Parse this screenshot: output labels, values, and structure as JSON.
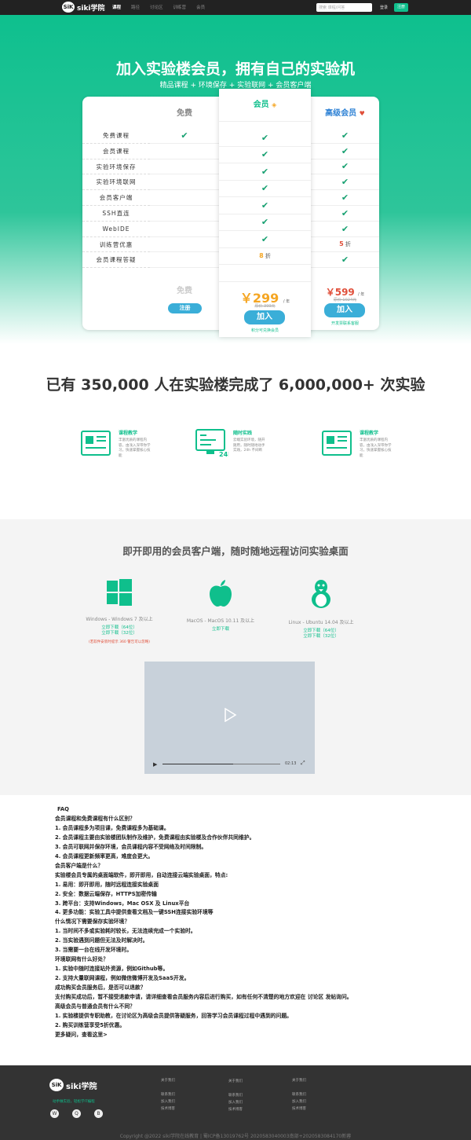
{
  "nav": {
    "logo_badge": "SiK",
    "logo_text": "siki学院",
    "links": [
      "课程",
      "路径",
      "讨论区",
      "训练营",
      "会员"
    ],
    "search_placeholder": "搜索 课程/问答",
    "login": "登录",
    "signup": "注册"
  },
  "hero": {
    "title": "加入实验楼会员，拥有自己的实验机",
    "subtitle": "精品课程 + 环境保存 + 实验联网 + 会员客户端"
  },
  "pricing": {
    "free_title": "免费",
    "member_title": "会员",
    "advanced_title": "高级会员",
    "features": [
      "免费课程",
      "会员课程",
      "实验环境保存",
      "实验环境联网",
      "会员客户端",
      "SSH直连",
      "WebIDE",
      "训练营优惠",
      "会员课程答疑"
    ],
    "free_checks": [
      true,
      false,
      false,
      false,
      false,
      false,
      false,
      false,
      false
    ],
    "member_checks": [
      true,
      true,
      true,
      true,
      true,
      true,
      true,
      false,
      false
    ],
    "advanced_checks": [
      true,
      true,
      true,
      true,
      true,
      true,
      true,
      false,
      true
    ],
    "member_discount_num": "8",
    "member_discount_unit": "折",
    "advanced_discount_num": "5",
    "advanced_discount_unit": "折",
    "free_price_label": "免费",
    "free_button": "注册",
    "member_price": "￥299",
    "member_price_unit": "/ 年",
    "member_old_price": "原价 399元",
    "member_button": "加入",
    "member_note": "积分可兑换会员",
    "advanced_price": "￥599",
    "advanced_price_unit": "/ 年",
    "advanced_old_price": "原价 1024元",
    "advanced_button": "加入",
    "advanced_note": "开发票联系客服"
  },
  "stats": "已有 350,000 人在实验楼完成了 6,000,000+ 次实验",
  "features": [
    {
      "title": "课程教学",
      "desc": "丰富优质的课程内容，由浅入深带你学习，快速掌握核心技能"
    },
    {
      "title": "随时实践",
      "desc": "云端实验环境，随开随用，随时随地动手实践，24h 不间断"
    },
    {
      "title": "课程教学",
      "desc": "丰富优质的课程内容，由浅入深带你学习，快速掌握核心技能"
    }
  ],
  "client": {
    "title": "即开即用的会员客户端，随时随地远程访问实验桌面",
    "windows_name": "Windows - Windows 7 及以上",
    "windows_link1": "立即下载（64位）",
    "windows_link2": "立即下载（32位）",
    "windows_note": "(若软件安装时提示 360 警告可以忽略)",
    "mac_name": "MacOS - MacOS 10.11 及以上",
    "mac_link": "立即下载",
    "linux_name": "Linux - Ubuntu 14.04 及以上",
    "linux_link1": "立即下载（64位）",
    "linux_link2": "立即下载（32位）",
    "video_time": "02:13"
  },
  "faq": [
    "FAQ",
    "会员课程和免费课程有什么区别？",
    "1. 会员课程多为项目课，免费课程多为基础课。",
    "2. 会员课程主要由实验楼团队制作及维护，免费课程由实验楼及合作伙伴共同维护。",
    "3. 会员可联网并保存环境，会员课程内容不受网络及时间限制。",
    "4. 会员课程更新频率更高，难度会更大。",
    "会员客户端是什么？",
    "实验楼会员专属的桌面端软件，即开即用，自动连接云端实验桌面，特点:",
    "1. 易用：即开即用，随时远程连接实验桌面",
    "2. 安全：数据云端保存，HTTPS加密传输",
    "3. 跨平台：支持Windows，Mac OSX 及 Linux平台",
    "4. 更多功能：实验工具中提供查看文档及一键SSH连接实验环境等",
    "什么情况下需要保存实验环境？",
    "1. 当时间不多或实验耗时较长，无法连续完成一个实验时。",
    "2. 当实验遇到问题但无法及时解决时。",
    "3. 当需要一台在线开发环境时。",
    "环境联网有什么好处？",
    "1. 实验中随时连接站外资源，例如Github等。",
    "2. 支持大量联网课程，例如微信微博开发及SaaS开发。",
    "成功购买会员服务后，是否可以退款？",
    "支付购买成功后，暂不接受退款申请，请详细查看会员服务内容后进行购买，如有任何不清楚的地方欢迎在 讨论区 发帖询问。",
    "高级会员与普通会员有什么不同？",
    "1. 实验楼提供专职助教，在讨论区为高级会员提供答疑服务，回答学习会员课程过程中遇到的问题。",
    "2. 购买训练营享受5折优惠。",
    "更多疑问，查看这里>"
  ],
  "footer": {
    "logo_badge": "SiK",
    "logo_text": "siki学院",
    "tagline": "动手做实验，轻松学IT编程",
    "col1": [
      "关于我们",
      "联系我们",
      "加入我们",
      "技术博客"
    ],
    "col2": [
      "关于我们",
      "联系我们",
      "加入我们",
      "技术博客"
    ],
    "col3": [
      "关于我们",
      "联系我们",
      "加入我们",
      "技术博客"
    ],
    "social": [
      "W",
      "Q",
      "B"
    ],
    "copyright": "Copyright @2022 siki学院在线教育 | 蜀ICP备13019762号 2020583040003南部+2020583084170新蓉"
  },
  "colors": {
    "accent": "#0fbf8c",
    "button_blue": "#3aaed8",
    "price_orange": "#f5a623",
    "price_red": "#e04f3a"
  }
}
